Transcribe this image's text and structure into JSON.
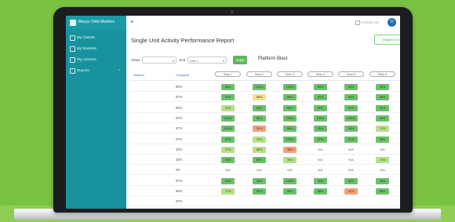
{
  "app": {
    "logo_text": "Macys Orbit Masters",
    "contact_label": "Contact Us",
    "user_initial": "U"
  },
  "sidebar": {
    "items": [
      {
        "label": "My Classes"
      },
      {
        "label": "My Students"
      },
      {
        "label": "My Licenses"
      },
      {
        "label": "Reports"
      }
    ]
  },
  "report": {
    "title": "Single Unit Activity Performance Report",
    "export_label": "Export to CSV",
    "filters": {
      "class_label": "Class",
      "class_value": "",
      "unit_label": "Unit",
      "unit_value": "Unit 1",
      "apply_label": "Apply",
      "school_label": "Platform Blast"
    },
    "columns": {
      "student": "Student",
      "completion": "Complete",
      "sessions": [
        "Sess 1",
        "Sess 2",
        "Sess 3",
        "Sess 4",
        "Sess 5",
        "Sess 6"
      ]
    },
    "rows": [
      {
        "completion": "88%",
        "cells": [
          "86%",
          "100%",
          "100%",
          "85%",
          "90%",
          "90%"
        ]
      },
      {
        "completion": "67%",
        "cells": [
          "92%",
          "58%",
          "95%",
          "95%",
          "96%",
          "95%"
        ]
      },
      {
        "completion": "86%",
        "cells": [
          "71%",
          "92%",
          "95%",
          "90%",
          "91%",
          "91%"
        ]
      },
      {
        "completion": "97%",
        "cells": [
          "100%",
          "96%",
          "100%",
          "100%",
          "100%",
          "95%"
        ]
      },
      {
        "completion": "67%",
        "cells": [
          "100%",
          "31%",
          "95%",
          "95%",
          "95%",
          "71%"
        ]
      },
      {
        "completion": "67%",
        "cells": [
          "92%",
          "71%",
          "100%",
          "97%",
          "91%",
          "96%"
        ]
      },
      {
        "completion": "33%",
        "cells": [
          "77%",
          "80%",
          "38%",
          "N/A",
          "N/A",
          "N/A"
        ]
      },
      {
        "completion": "33%",
        "cells": [
          "90%",
          "86%",
          "76%",
          "N/A",
          "N/A",
          "71%"
        ]
      },
      {
        "completion": "0%",
        "cells": [
          "N/A",
          "N/A",
          "N/A",
          "N/A",
          "N/A",
          "N/A"
        ]
      },
      {
        "completion": "67%",
        "cells": [
          "92%",
          "96%",
          "100%",
          "95%",
          "95%",
          "95%"
        ]
      },
      {
        "completion": "86%",
        "cells": [
          "77%",
          "91%",
          "95%",
          "86%",
          "41%",
          "95%"
        ]
      },
      {
        "completion": "67%",
        "cells": [
          "",
          "",
          "",
          "",
          "",
          ""
        ]
      }
    ]
  },
  "colors": {
    "brand": "#18939e",
    "page_background": "#7cc242",
    "cell_high": "#6cc06c",
    "cell_mid": "#b7e08a",
    "cell_low": "#f3e08c",
    "cell_very_low": "#f0a07a"
  }
}
